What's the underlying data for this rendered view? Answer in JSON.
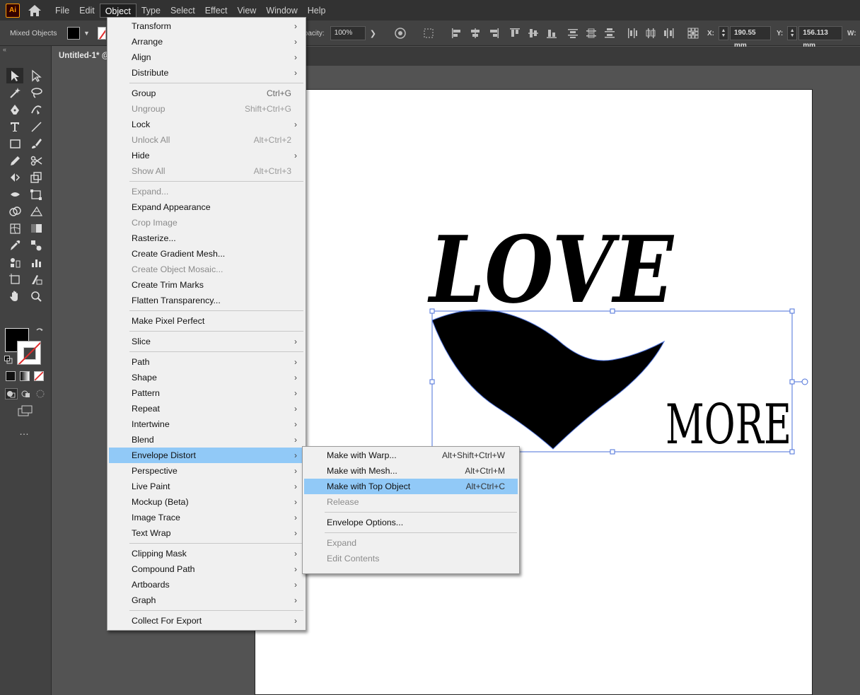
{
  "app": {
    "logo_text": "Ai",
    "accent_color": "#ff9a00"
  },
  "menubar": {
    "items": [
      "File",
      "Edit",
      "Object",
      "Type",
      "Select",
      "Effect",
      "View",
      "Window",
      "Help"
    ],
    "active": "Object"
  },
  "controlbar": {
    "selection_type": "Mixed Objects",
    "opacity_label": "Opacity:",
    "opacity_value": "100%",
    "x_label": "X:",
    "x_value": "190.55 mm",
    "y_label": "Y:",
    "y_value": "156.113 mm",
    "w_label": "W:"
  },
  "document": {
    "tab_title": "Untitled-1* @"
  },
  "artwork": {
    "word_top": "LOVE",
    "word_bottom": "MORE",
    "selection_color": "#4a6fd8"
  },
  "object_menu": {
    "items": [
      {
        "label": "Transform",
        "shortcut": "",
        "submenu": true,
        "disabled": false
      },
      {
        "label": "Arrange",
        "shortcut": "",
        "submenu": true,
        "disabled": false
      },
      {
        "label": "Align",
        "shortcut": "",
        "submenu": true,
        "disabled": false
      },
      {
        "label": "Distribute",
        "shortcut": "",
        "submenu": true,
        "disabled": false
      },
      {
        "label": "Group",
        "shortcut": "Ctrl+G",
        "submenu": false,
        "disabled": false
      },
      {
        "label": "Ungroup",
        "shortcut": "Shift+Ctrl+G",
        "submenu": false,
        "disabled": true
      },
      {
        "label": "Lock",
        "shortcut": "",
        "submenu": true,
        "disabled": false
      },
      {
        "label": "Unlock All",
        "shortcut": "Alt+Ctrl+2",
        "submenu": false,
        "disabled": true
      },
      {
        "label": "Hide",
        "shortcut": "",
        "submenu": true,
        "disabled": false
      },
      {
        "label": "Show All",
        "shortcut": "Alt+Ctrl+3",
        "submenu": false,
        "disabled": true
      },
      {
        "label": "Expand...",
        "shortcut": "",
        "submenu": false,
        "disabled": true
      },
      {
        "label": "Expand Appearance",
        "shortcut": "",
        "submenu": false,
        "disabled": false
      },
      {
        "label": "Crop Image",
        "shortcut": "",
        "submenu": false,
        "disabled": true
      },
      {
        "label": "Rasterize...",
        "shortcut": "",
        "submenu": false,
        "disabled": false
      },
      {
        "label": "Create Gradient Mesh...",
        "shortcut": "",
        "submenu": false,
        "disabled": false
      },
      {
        "label": "Create Object Mosaic...",
        "shortcut": "",
        "submenu": false,
        "disabled": true
      },
      {
        "label": "Create Trim Marks",
        "shortcut": "",
        "submenu": false,
        "disabled": false
      },
      {
        "label": "Flatten Transparency...",
        "shortcut": "",
        "submenu": false,
        "disabled": false
      },
      {
        "label": "Make Pixel Perfect",
        "shortcut": "",
        "submenu": false,
        "disabled": false
      },
      {
        "label": "Slice",
        "shortcut": "",
        "submenu": true,
        "disabled": false
      },
      {
        "label": "Path",
        "shortcut": "",
        "submenu": true,
        "disabled": false
      },
      {
        "label": "Shape",
        "shortcut": "",
        "submenu": true,
        "disabled": false
      },
      {
        "label": "Pattern",
        "shortcut": "",
        "submenu": true,
        "disabled": false
      },
      {
        "label": "Repeat",
        "shortcut": "",
        "submenu": true,
        "disabled": false
      },
      {
        "label": "Intertwine",
        "shortcut": "",
        "submenu": true,
        "disabled": false
      },
      {
        "label": "Blend",
        "shortcut": "",
        "submenu": true,
        "disabled": false
      },
      {
        "label": "Envelope Distort",
        "shortcut": "",
        "submenu": true,
        "disabled": false,
        "highlighted": true
      },
      {
        "label": "Perspective",
        "shortcut": "",
        "submenu": true,
        "disabled": false
      },
      {
        "label": "Live Paint",
        "shortcut": "",
        "submenu": true,
        "disabled": false
      },
      {
        "label": "Mockup (Beta)",
        "shortcut": "",
        "submenu": true,
        "disabled": false
      },
      {
        "label": "Image Trace",
        "shortcut": "",
        "submenu": true,
        "disabled": false
      },
      {
        "label": "Text Wrap",
        "shortcut": "",
        "submenu": true,
        "disabled": false
      },
      {
        "label": "Clipping Mask",
        "shortcut": "",
        "submenu": true,
        "disabled": false
      },
      {
        "label": "Compound Path",
        "shortcut": "",
        "submenu": true,
        "disabled": false
      },
      {
        "label": "Artboards",
        "shortcut": "",
        "submenu": true,
        "disabled": false
      },
      {
        "label": "Graph",
        "shortcut": "",
        "submenu": true,
        "disabled": false
      },
      {
        "label": "Collect For Export",
        "shortcut": "",
        "submenu": true,
        "disabled": false
      }
    ]
  },
  "envelope_submenu": {
    "items": [
      {
        "label": "Make with Warp...",
        "shortcut": "Alt+Shift+Ctrl+W",
        "disabled": false
      },
      {
        "label": "Make with Mesh...",
        "shortcut": "Alt+Ctrl+M",
        "disabled": false
      },
      {
        "label": "Make with Top Object",
        "shortcut": "Alt+Ctrl+C",
        "disabled": false,
        "highlighted": true
      },
      {
        "label": "Release",
        "shortcut": "",
        "disabled": true
      },
      {
        "label": "Envelope Options...",
        "shortcut": "",
        "disabled": false
      },
      {
        "label": "Expand",
        "shortcut": "",
        "disabled": true
      },
      {
        "label": "Edit Contents",
        "shortcut": "",
        "disabled": true
      }
    ]
  },
  "tools": [
    "selection-tool",
    "direct-selection-tool",
    "magic-wand-tool",
    "lasso-tool",
    "pen-tool",
    "curvature-tool",
    "type-tool",
    "line-tool",
    "rectangle-tool",
    "paintbrush-tool",
    "pencil-tool",
    "scissors-tool",
    "rotate-tool",
    "scale-tool",
    "width-tool",
    "free-transform-tool",
    "shape-builder-tool",
    "perspective-grid-tool",
    "mesh-tool",
    "gradient-tool",
    "eyedropper-tool",
    "blend-tool",
    "symbol-sprayer-tool",
    "graph-tool",
    "artboard-tool",
    "slice-tool",
    "hand-tool",
    "zoom-tool"
  ]
}
